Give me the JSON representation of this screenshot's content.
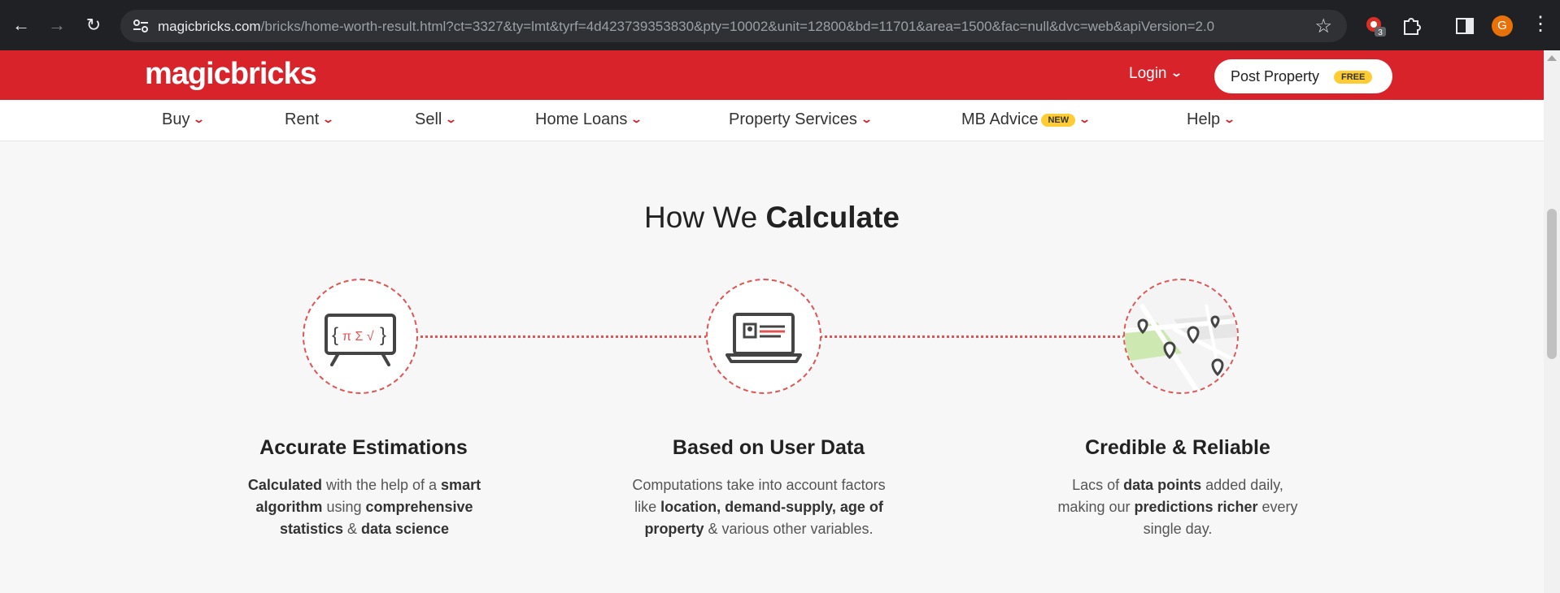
{
  "browser": {
    "url_host": "magicbricks.com",
    "url_path": "/bricks/home-worth-result.html?ct=3327&ty=lmt&tyrf=4d423739353830&pty=10002&unit=12800&bd=11701&area=1500&fac=null&dvc=web&apiVersion=2.0",
    "extension_badge": "3",
    "profile_initial": "G"
  },
  "header": {
    "logo": "magicbricks",
    "login_label": "Login",
    "post_property_label": "Post Property",
    "free_badge": "FREE"
  },
  "nav": {
    "items": [
      {
        "label": "Buy"
      },
      {
        "label": "Rent"
      },
      {
        "label": "Sell"
      },
      {
        "label": "Home Loans"
      },
      {
        "label": "Property Services"
      },
      {
        "label": "MB Advice",
        "badge": "NEW"
      },
      {
        "label": "Help"
      }
    ]
  },
  "section": {
    "heading_regular": "How We",
    "heading_bold": "Calculate",
    "features": [
      {
        "title": "Accurate Estimations",
        "desc": [
          {
            "t": "Calculated",
            "b": true
          },
          {
            "t": " with the help of a ",
            "b": false
          },
          {
            "t": "smart algorithm",
            "b": true
          },
          {
            "t": " using ",
            "b": false
          },
          {
            "t": "comprehensive statistics",
            "b": true
          },
          {
            "t": " & ",
            "b": false
          },
          {
            "t": "data science",
            "b": true
          }
        ],
        "icon": "formula-board-icon"
      },
      {
        "title": "Based on User Data",
        "desc": [
          {
            "t": "Computations take into account factors like ",
            "b": false
          },
          {
            "t": "location, demand-supply, age of property",
            "b": true
          },
          {
            "t": " & various other variables.",
            "b": false
          }
        ],
        "icon": "laptop-icon"
      },
      {
        "title": "Credible & Reliable",
        "desc": [
          {
            "t": "Lacs of ",
            "b": false
          },
          {
            "t": "data points",
            "b": true
          },
          {
            "t": " added daily, making our ",
            "b": false
          },
          {
            "t": "predictions richer",
            "b": true
          },
          {
            "t": " every single day.",
            "b": false
          }
        ],
        "icon": "map-pins-icon"
      }
    ]
  },
  "colors": {
    "brand": "#d8232a",
    "badge": "#ffcc33"
  }
}
